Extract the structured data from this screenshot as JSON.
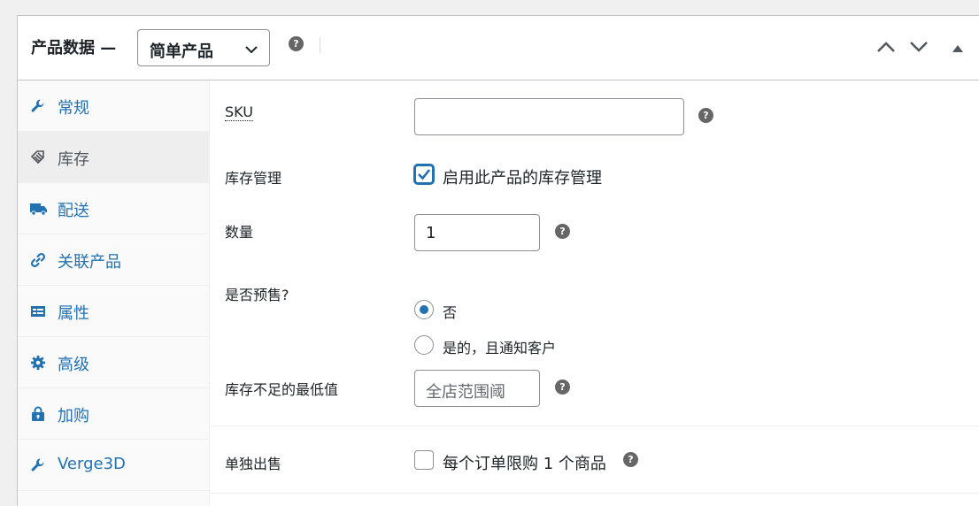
{
  "header": {
    "title": "产品数据 —",
    "product_type": "简单产品",
    "help": "?",
    "icons": [
      "chevron-up-icon",
      "chevron-down-icon",
      "triangle-up-icon"
    ]
  },
  "tabs": [
    {
      "label": "常规",
      "icon": "wrench-icon",
      "active": false
    },
    {
      "label": "库存",
      "icon": "tag-icon",
      "active": true
    },
    {
      "label": "配送",
      "icon": "truck-icon",
      "active": false
    },
    {
      "label": "关联产品",
      "icon": "link-icon",
      "active": false
    },
    {
      "label": "属性",
      "icon": "list-card-icon",
      "active": false
    },
    {
      "label": "高级",
      "icon": "gear-icon",
      "active": false
    },
    {
      "label": "加购",
      "icon": "bag-lock-icon",
      "active": false
    },
    {
      "label": "Verge3D",
      "icon": "wrench-icon",
      "active": false
    }
  ],
  "fields": {
    "sku": {
      "label": "SKU",
      "value": "",
      "help": "?"
    },
    "stock_management": {
      "label": "库存管理",
      "checkbox_label": "启用此产品的库存管理",
      "checked": true
    },
    "quantity": {
      "label": "数量",
      "value": "1",
      "help": "?"
    },
    "backorders": {
      "label": "是否预售?",
      "options": [
        "否",
        "是的，且通知客户"
      ],
      "selected": "否"
    },
    "low_stock": {
      "label": "库存不足的最低值",
      "placeholder": "全店范围阈",
      "help": "?"
    },
    "sold_individually": {
      "label": "单独出售",
      "checkbox_label": "每个订单限购 1 个商品",
      "checked": false,
      "help": "?"
    }
  },
  "colors": {
    "accent": "#2271b1",
    "help_bg": "#666666",
    "border": "#c3c4c7"
  }
}
